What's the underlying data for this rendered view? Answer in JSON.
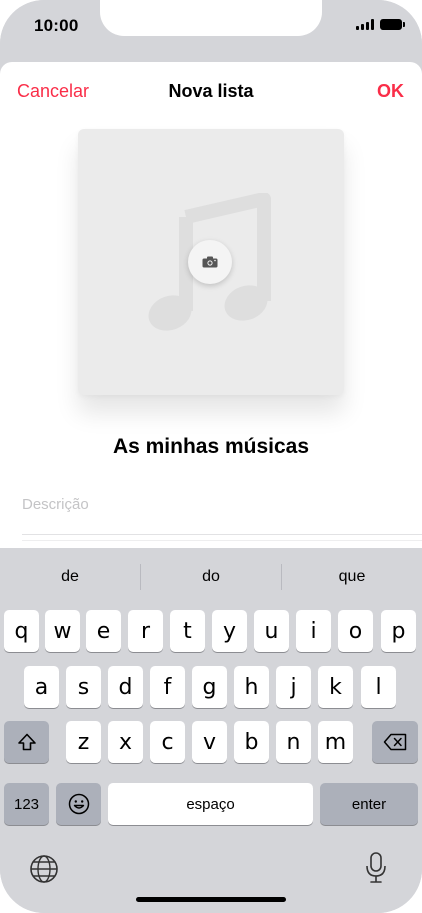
{
  "status_bar": {
    "time": "10:00"
  },
  "nav": {
    "cancel_label": "Cancelar",
    "title": "Nova lista",
    "ok_label": "OK"
  },
  "playlist": {
    "name": "As minhas músicas",
    "description_placeholder": "Descrição"
  },
  "colors": {
    "accent": "#fa2d48",
    "keyboard_bg": "#d4d5d9",
    "key_bg": "#ffffff",
    "special_key_bg": "#acb0ba"
  },
  "icons": [
    "camera-icon",
    "music-note-icon",
    "shift-icon",
    "delete-icon",
    "emoji-icon",
    "globe-icon",
    "microphone-icon"
  ],
  "keyboard": {
    "suggestions": [
      "de",
      "do",
      "que"
    ],
    "row1": [
      "q",
      "w",
      "e",
      "r",
      "t",
      "y",
      "u",
      "i",
      "o",
      "p"
    ],
    "row2": [
      "a",
      "s",
      "d",
      "f",
      "g",
      "h",
      "j",
      "k",
      "l"
    ],
    "row3": [
      "z",
      "x",
      "c",
      "v",
      "b",
      "n",
      "m"
    ],
    "numbers_label": "123",
    "space_label": "espaço",
    "enter_label": "enter"
  }
}
